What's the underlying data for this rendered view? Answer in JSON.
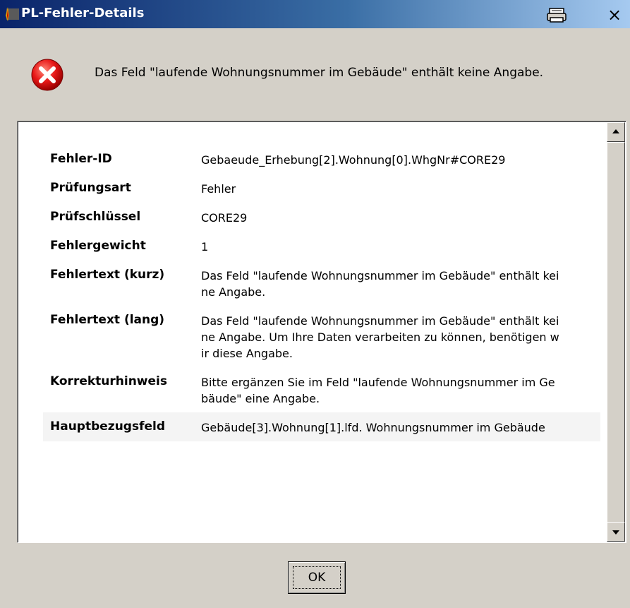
{
  "window": {
    "title": "PL-Fehler-Details",
    "close_label": "×"
  },
  "message": "Das Feld \"laufende Wohnungsnummer im Gebäude\" enthält keine Angabe.",
  "details": {
    "rows": [
      {
        "label": "Fehler-ID",
        "value": "Gebaeude_Erhebung[2].Wohnung[0].WhgNr#CORE29"
      },
      {
        "label": "Prüfungsart",
        "value": "Fehler"
      },
      {
        "label": "Prüfschlüssel",
        "value": "CORE29"
      },
      {
        "label": "Fehlergewicht",
        "value": "1"
      },
      {
        "label": "Fehlertext (kurz)",
        "value": "Das Feld \"laufende Wohnungsnummer im Gebäude\" enthält keine Angabe."
      },
      {
        "label": "Fehlertext (lang)",
        "value": "Das Feld \"laufende Wohnungsnummer im Gebäude\" enthält keine Angabe. Um Ihre Daten verarbeiten zu können, benötigen wir diese Angabe."
      },
      {
        "label": "Korrekturhinweis",
        "value": "Bitte ergänzen Sie im Feld \"laufende Wohnungsnummer im Gebäude\" eine Angabe."
      },
      {
        "label": "Hauptbezugsfeld",
        "value": "Gebäude[3].Wohnung[1].lfd. Wohnungsnummer im Gebäude"
      }
    ]
  },
  "buttons": {
    "ok": "OK"
  },
  "icons": {
    "app": "app-icon",
    "print": "printer-icon",
    "error": "error-icon",
    "scroll_up": "scroll-up-arrow-icon",
    "scroll_down": "scroll-down-arrow-icon"
  },
  "colors": {
    "titlebar_start": "#0a246a",
    "titlebar_end": "#a6caf0",
    "error_red": "#e81818",
    "dialog_bg": "#d4d0c8"
  }
}
